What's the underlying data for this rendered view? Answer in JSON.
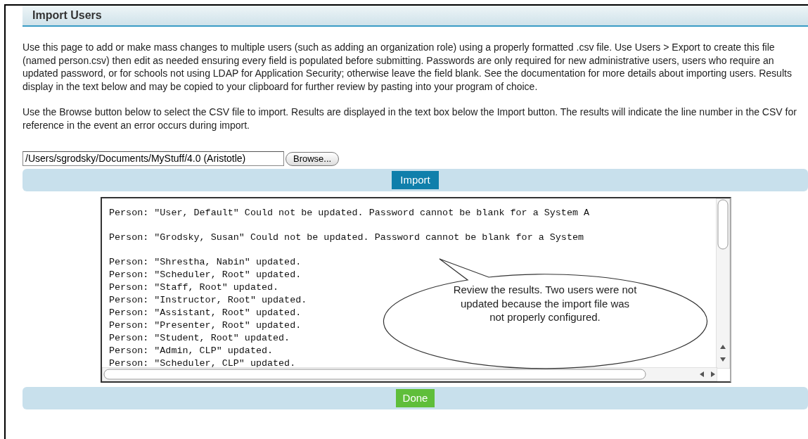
{
  "page_title": "Import Users",
  "paragraphs": [
    "Use this page to add or make mass changes to multiple users (such as adding an organization role) using a properly formatted .csv file. Use Users > Export to create this file (named person.csv) then edit as needed ensuring every field is populated before submitting. Passwords are only required for new administrative users, users who require an updated password, or for schools not using LDAP for Application Security; otherwise leave the field blank. See the documentation for more details about importing users. Results display in the text below and may be copied to your clipboard for further review by pasting into your program of choice.",
    "Use the Browse button below to select the CSV file to import. Results are displayed in the text box below the Import button. The results will indicate the line number in the CSV for reference in the event an error occurs during import."
  ],
  "file_field": {
    "value": "/Users/sgrodsky/Documents/MyStuff/4.0 (Aristotle)"
  },
  "browse_button": "Browse...",
  "import_button": "Import",
  "results": [
    {
      "kind": "error",
      "text": "Person: \"User, Default\" Could not be updated. Password cannot be blank for a System A"
    },
    {
      "kind": "error",
      "text": "Person: \"Grodsky, Susan\" Could not be updated. Password cannot be blank for a System"
    },
    {
      "kind": "success",
      "text": "Person: \"Shrestha, Nabin\" updated."
    },
    {
      "kind": "success",
      "text": "Person: \"Scheduler, Root\" updated."
    },
    {
      "kind": "success",
      "text": "Person: \"Staff, Root\" updated."
    },
    {
      "kind": "success",
      "text": "Person: \"Instructor, Root\" updated."
    },
    {
      "kind": "success",
      "text": "Person: \"Assistant, Root\" updated."
    },
    {
      "kind": "success",
      "text": "Person: \"Presenter, Root\" updated."
    },
    {
      "kind": "success",
      "text": "Person: \"Student, Root\" updated."
    },
    {
      "kind": "success",
      "text": "Person: \"Admin, CLP\" updated."
    },
    {
      "kind": "success",
      "text": "Person: \"Scheduler, CLP\" updated."
    }
  ],
  "callout": "Review the results. Two users were not updated because the import file was not properly configured.",
  "done_button": "Done"
}
